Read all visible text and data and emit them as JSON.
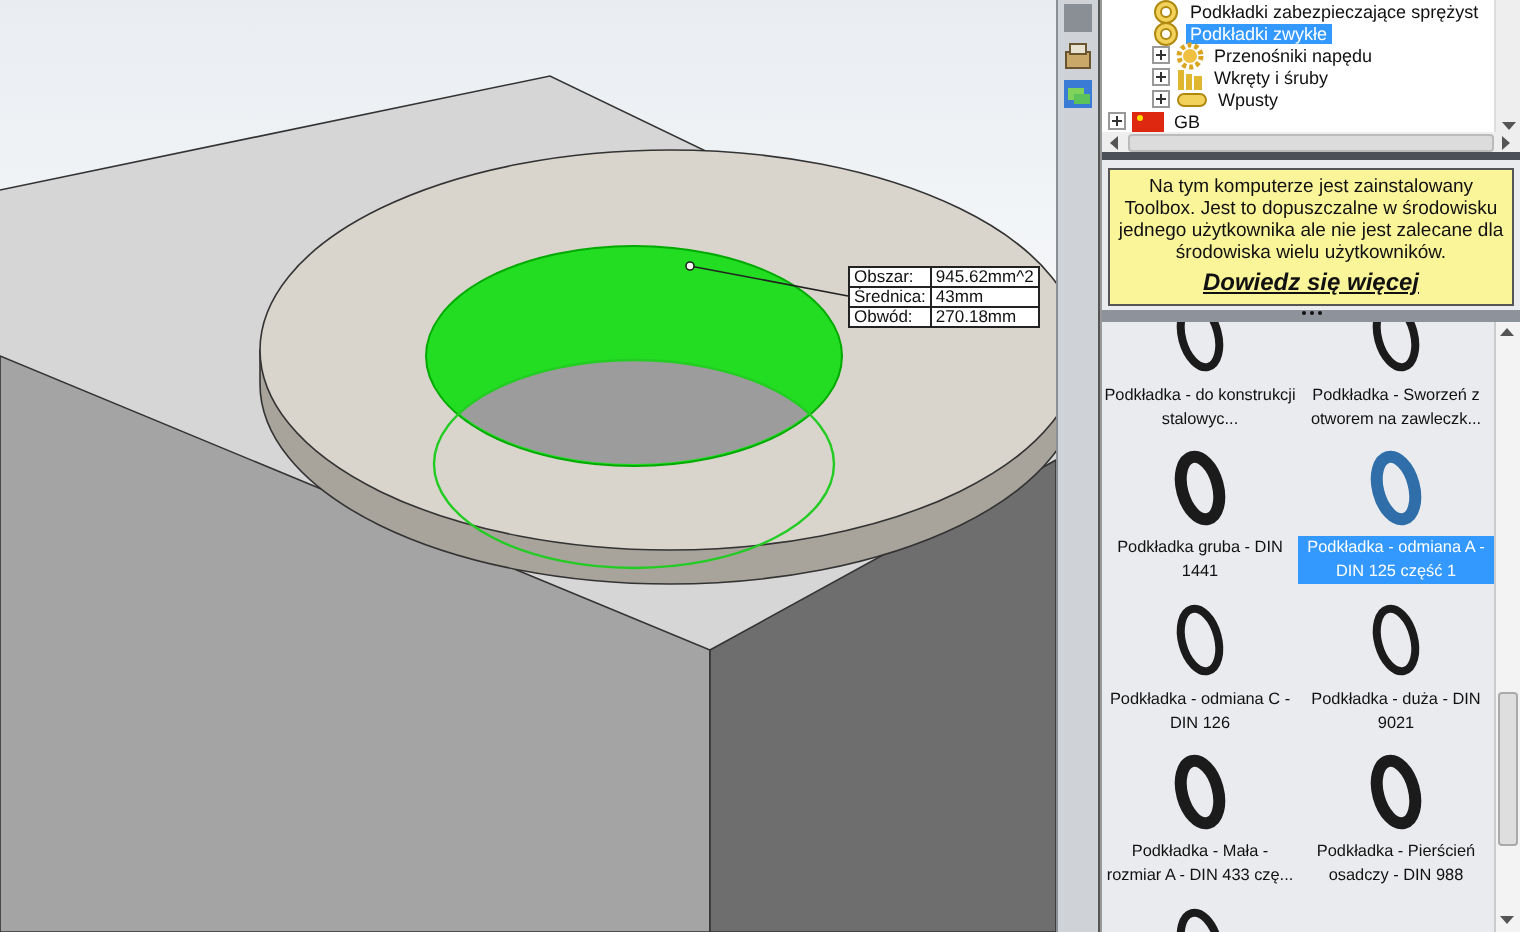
{
  "viewport": {
    "measurement": {
      "rows": [
        {
          "label": "Obszar:",
          "value": "945.62mm^2"
        },
        {
          "label": "Średnica:",
          "value": "43mm"
        },
        {
          "label": "Obwód:",
          "value": "270.18mm"
        }
      ]
    }
  },
  "tree": {
    "items": [
      {
        "children": [
          {
            "label": "Podkładki zabezpieczające sprężyst",
            "kind": "washer",
            "selected": false
          },
          {
            "label": "Podkładki zwykłe",
            "kind": "washer",
            "selected": true
          },
          {
            "label": "Przenośniki napędu",
            "kind": "gear",
            "expanded": false,
            "selected": false
          },
          {
            "label": "Wkręty i śruby",
            "kind": "screw",
            "expanded": false,
            "selected": false
          },
          {
            "label": "Wpusty",
            "kind": "key",
            "expanded": false,
            "selected": false
          }
        ]
      },
      {
        "label": "GB",
        "kind": "flag",
        "expanded": false,
        "selected": false
      }
    ]
  },
  "notice": {
    "text": "Na tym komputerze jest zainstalowany Toolbox. Jest to dopuszczalne w środowisku jednego użytkownika ale nie jest zalecane dla środowiska wielu użytkowników.",
    "link": "Dowiedz się więcej"
  },
  "parts": [
    {
      "label": "Podkładka - do konstrukcji stalowyc...",
      "selected": false
    },
    {
      "label": "Podkładka - Sworzeń z otworem na zawleczk...",
      "selected": false
    },
    {
      "label": "Podkładka gruba - DIN 1441",
      "selected": false
    },
    {
      "label": "Podkładka - odmiana A - DIN 125 część 1",
      "selected": true
    },
    {
      "label": "Podkładka - odmiana C - DIN 126",
      "selected": false
    },
    {
      "label": "Podkładka - duża - DIN 9021",
      "selected": false
    },
    {
      "label": "Podkładka - Mała - rozmiar A - DIN 433 czę...",
      "selected": false
    },
    {
      "label": "Podkładka - Pierścień osadczy - DIN 988",
      "selected": false
    }
  ]
}
